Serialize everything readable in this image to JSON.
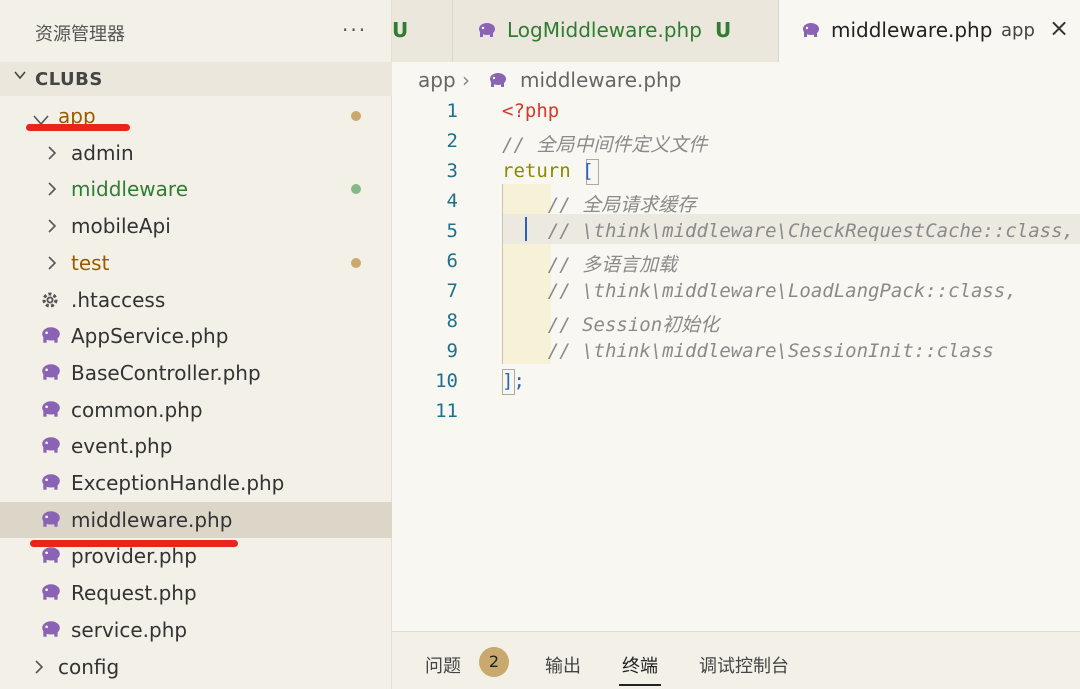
{
  "sidebar": {
    "title": "资源管理器",
    "more": "···",
    "section": "CLUBS",
    "items": [
      {
        "label": "app",
        "type": "folder",
        "expanded": true,
        "color": "#9a5b00",
        "dot": "#c9a96e"
      },
      {
        "label": "admin",
        "type": "folder",
        "expanded": false,
        "color": "#333333"
      },
      {
        "label": "middleware",
        "type": "folder",
        "expanded": false,
        "color": "#2f7d32",
        "dot": "#86b787"
      },
      {
        "label": "mobileApi",
        "type": "folder",
        "expanded": false,
        "color": "#333333"
      },
      {
        "label": "test",
        "type": "folder",
        "expanded": false,
        "color": "#9a5b00",
        "dot": "#c9a96e"
      },
      {
        "label": ".htaccess",
        "type": "file",
        "icon": "gear-icon"
      },
      {
        "label": "AppService.php",
        "type": "file",
        "icon": "php-elephant-icon"
      },
      {
        "label": "BaseController.php",
        "type": "file",
        "icon": "php-elephant-icon"
      },
      {
        "label": "common.php",
        "type": "file",
        "icon": "php-elephant-icon"
      },
      {
        "label": "event.php",
        "type": "file",
        "icon": "php-elephant-icon"
      },
      {
        "label": "ExceptionHandle.php",
        "type": "file",
        "icon": "php-elephant-icon"
      },
      {
        "label": "middleware.php",
        "type": "file",
        "icon": "php-elephant-icon",
        "selected": true
      },
      {
        "label": "provider.php",
        "type": "file",
        "icon": "php-elephant-icon"
      },
      {
        "label": "Request.php",
        "type": "file",
        "icon": "php-elephant-icon"
      },
      {
        "label": "service.php",
        "type": "file",
        "icon": "php-elephant-icon"
      },
      {
        "label": "config",
        "type": "folder",
        "expanded": false,
        "color": "#333333"
      }
    ]
  },
  "tabs": [
    {
      "label": "U",
      "status": "",
      "color": "#2f7d32"
    },
    {
      "label": "LogMiddleware.php",
      "status": "U",
      "color": "#2f7d32"
    },
    {
      "label": "middleware.php",
      "status": "app",
      "color": "#222222",
      "active": true,
      "close": "×"
    }
  ],
  "breadcrumb": {
    "folder": "app",
    "sep": "›",
    "file": "middleware.php"
  },
  "code": {
    "line_numbers": [
      "1",
      "2",
      "3",
      "4",
      "5",
      "6",
      "7",
      "8",
      "9",
      "10",
      "11"
    ],
    "lines": [
      {
        "text": "<?php",
        "kind": "tag"
      },
      {
        "text": "// 全局中间件定义文件",
        "kind": "comment"
      },
      {
        "text": "return [",
        "kind": "return"
      },
      {
        "text": "    // 全局请求缓存",
        "kind": "comment"
      },
      {
        "text": "    // \\think\\middleware\\CheckRequestCache::class,",
        "kind": "comment"
      },
      {
        "text": "    // 多语言加载",
        "kind": "comment"
      },
      {
        "text": "    // \\think\\middleware\\LoadLangPack::class,",
        "kind": "comment"
      },
      {
        "text": "    // Session初始化",
        "kind": "comment"
      },
      {
        "text": "    // \\think\\middleware\\SessionInit::class",
        "kind": "comment"
      },
      {
        "text": "];",
        "kind": "close"
      },
      {
        "text": "",
        "kind": "plain"
      }
    ]
  },
  "panel": {
    "tabs": [
      "问题",
      "输出",
      "终端",
      "调试控制台"
    ],
    "problems_count": "2",
    "active": "终端"
  },
  "colors": {
    "annotation": "#e9251b",
    "php_icon": "#8a63b5"
  }
}
